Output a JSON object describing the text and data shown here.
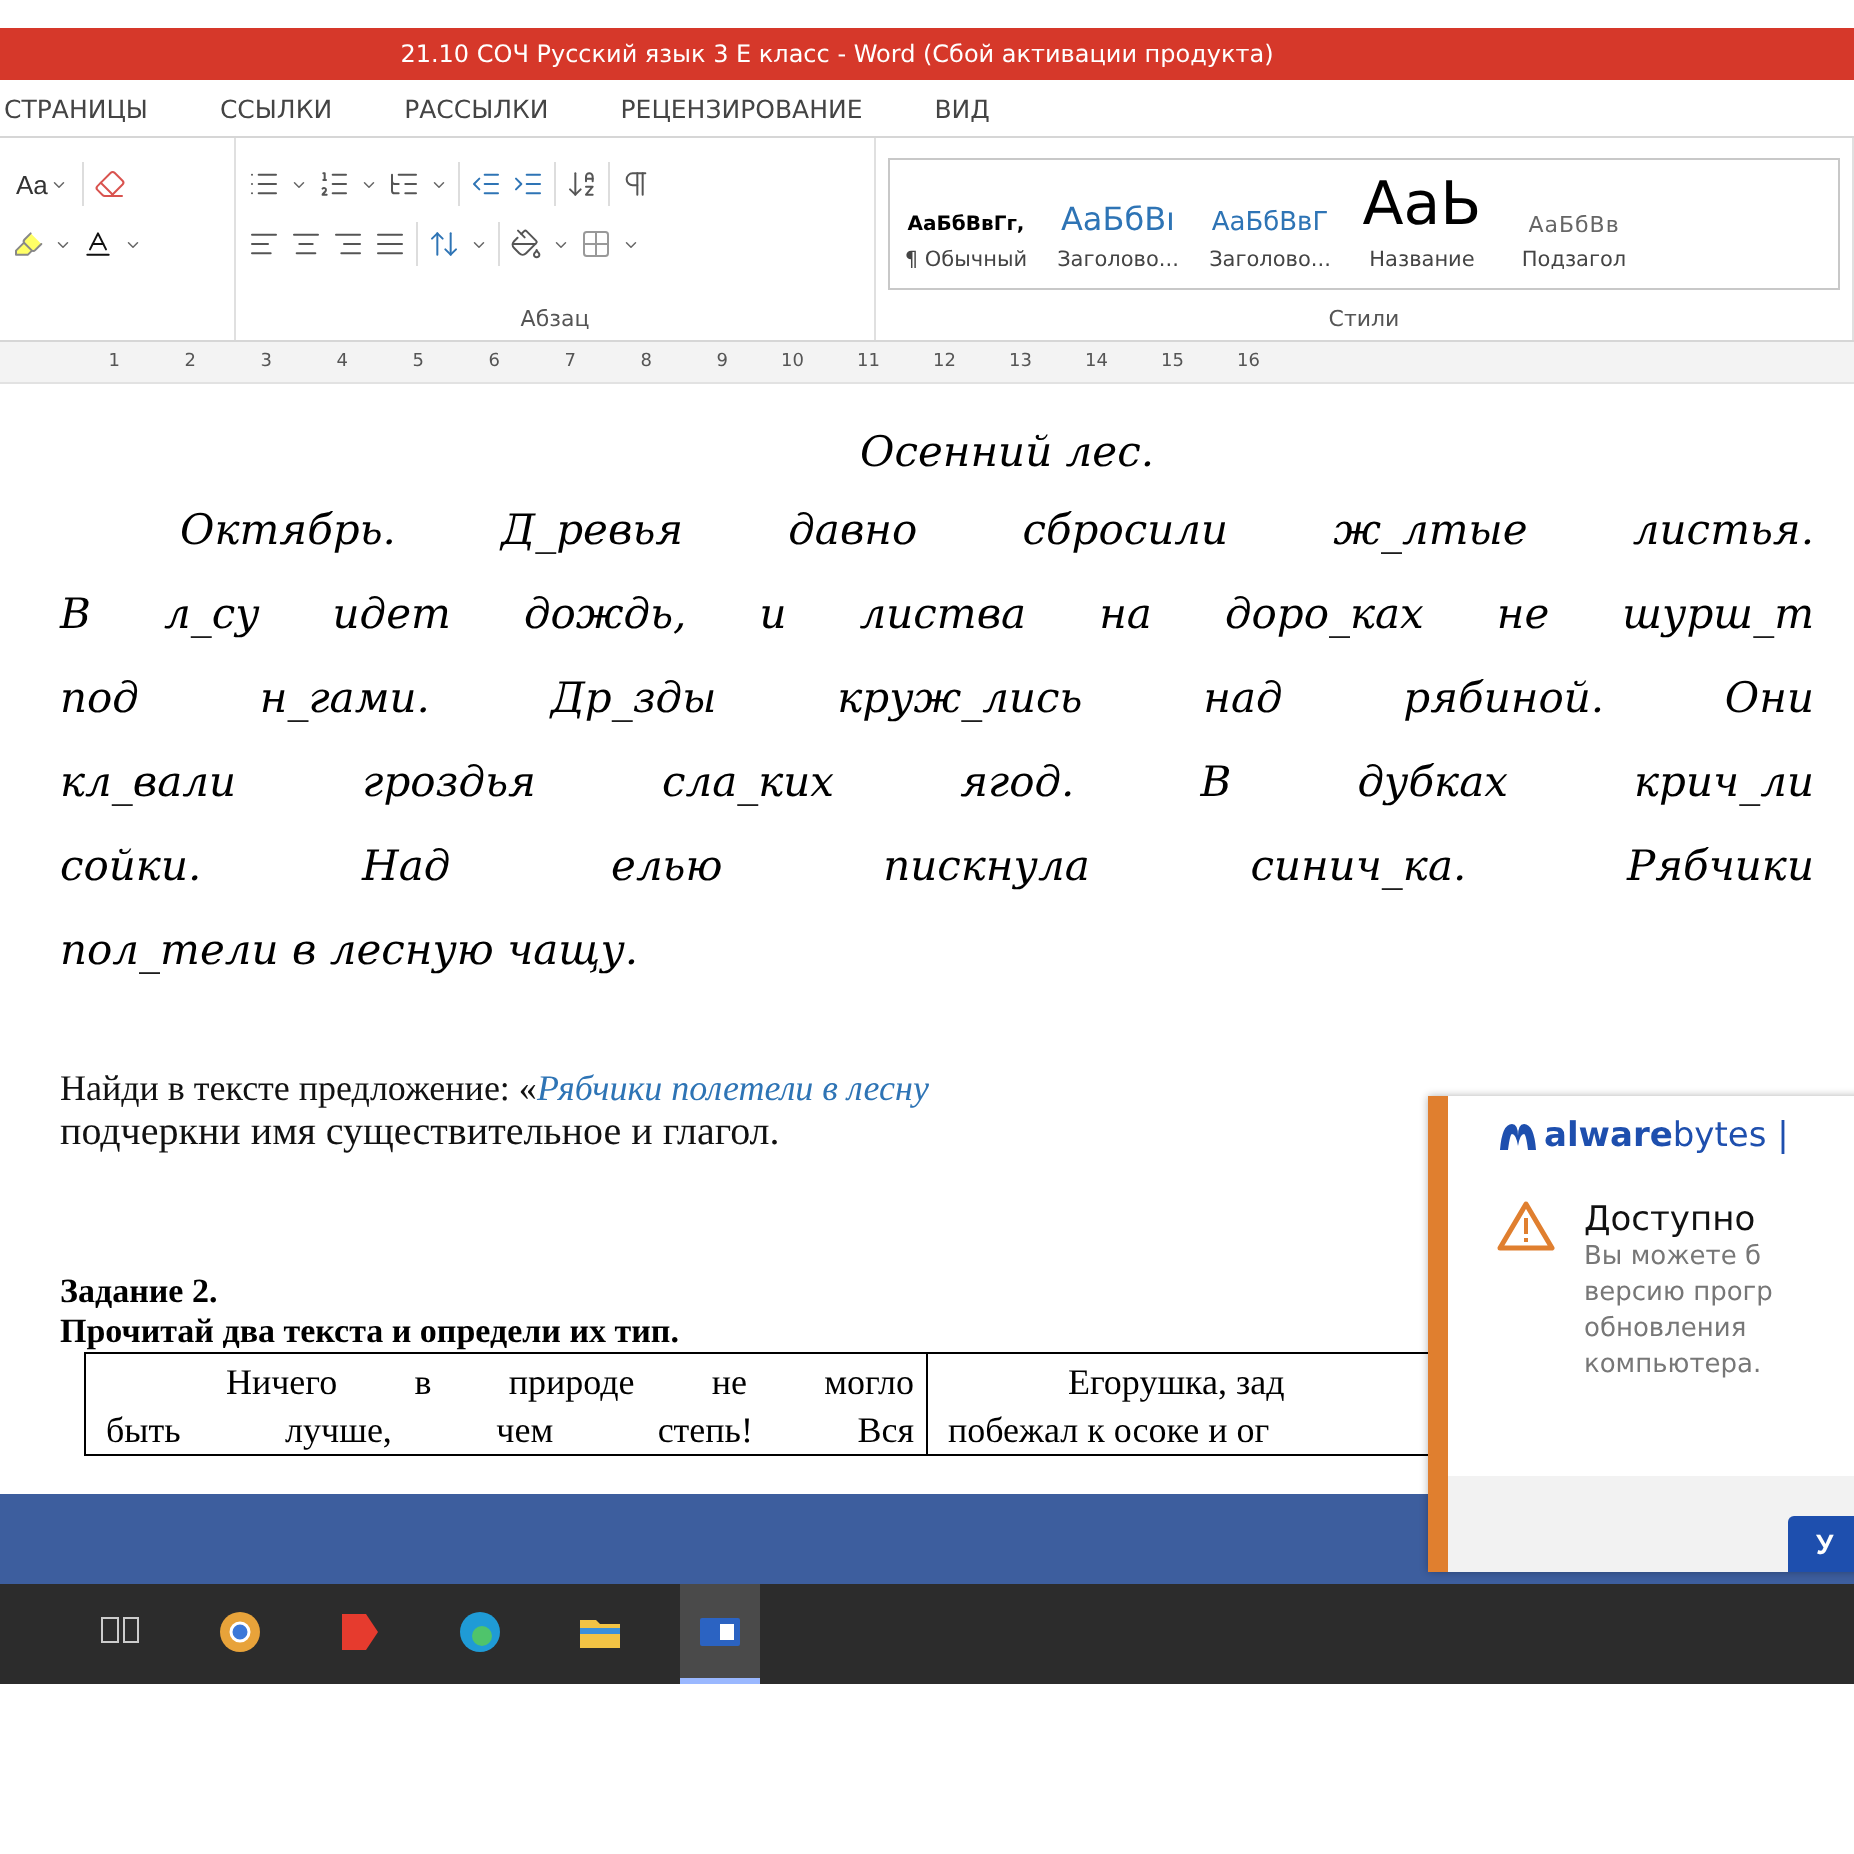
{
  "window": {
    "title": "21.10 СОЧ Русский язык 3 Е класс - Word (Сбой активации продукта)"
  },
  "ribbon_tabs": [
    "СТРАНИЦЫ",
    "ССЫЛКИ",
    "РАССЫЛКИ",
    "РЕЦЕНЗИРОВАНИЕ",
    "ВИД"
  ],
  "ribbon": {
    "case_button": "Aa",
    "paragraph_label": "Абзац",
    "styles_label": "Стили",
    "styles": [
      {
        "kind": "normal",
        "preview": "АаБбВвГг,",
        "name": "¶ Обычный"
      },
      {
        "kind": "heading1",
        "preview": "АаБбВı",
        "name": "Заголово..."
      },
      {
        "kind": "heading2",
        "preview": "АаБбВвГ",
        "name": "Заголово..."
      },
      {
        "kind": "title",
        "preview": "АаЬ",
        "name": "Название"
      },
      {
        "kind": "subtitle",
        "preview": "АаБбВв",
        "name": "Подзагол"
      }
    ]
  },
  "ruler": {
    "numbers": [
      "1",
      "2",
      "3",
      "4",
      "5",
      "6",
      "7",
      "8",
      "9",
      "10",
      "11",
      "12",
      "13",
      "14",
      "15",
      "16"
    ]
  },
  "document": {
    "title": "Осенний лес.",
    "text_lines": [
      "Октябрь. Д_ревья давно сбросили ж_лтые листья.",
      "В л_су идет дождь, и листва на доро_ках не шурш_т",
      "под н_гами. Др_зды круж_лись над рябиной. Они",
      "кл_вали гроздья сла_ких ягод. В дубках крич_ли",
      "сойки. Над елью пискнула синич_ка. Рябчики",
      "пол_тели в лесную чащу."
    ],
    "task_1": [
      {
        "kind": "plain",
        "text": "Найди в тексте предложение: «"
      },
      {
        "kind": "quote",
        "text": "Рябчики полетели в лесну"
      }
    ],
    "task_1_line_2": "подчеркни имя существительное и глагол.",
    "task_2_heading": "Задание 2.",
    "task_2_text": "Прочитай два текста и определи их тип.",
    "table_cells": [
      {
        "lines": [
          "Ничего в природе не могло",
          "быть лучше, чем степь! Вся"
        ]
      },
      {
        "lines": [
          "Егорушка, зад",
          "побежал к осоке и ог"
        ]
      }
    ]
  },
  "notification": {
    "brand": "**alware**bytes |",
    "heading": "Доступно",
    "body_lines": [
      "Вы можете б",
      "версию прогр",
      "обновления",
      "компьютера."
    ],
    "button": "У"
  },
  "taskbar": {
    "apps": [
      {
        "kind": "taskview",
        "active": false
      },
      {
        "kind": "chrome",
        "active": false
      },
      {
        "kind": "yandex",
        "active": false
      },
      {
        "kind": "edge",
        "active": false
      },
      {
        "kind": "folder",
        "active": false
      },
      {
        "kind": "word",
        "active": true
      }
    ]
  }
}
